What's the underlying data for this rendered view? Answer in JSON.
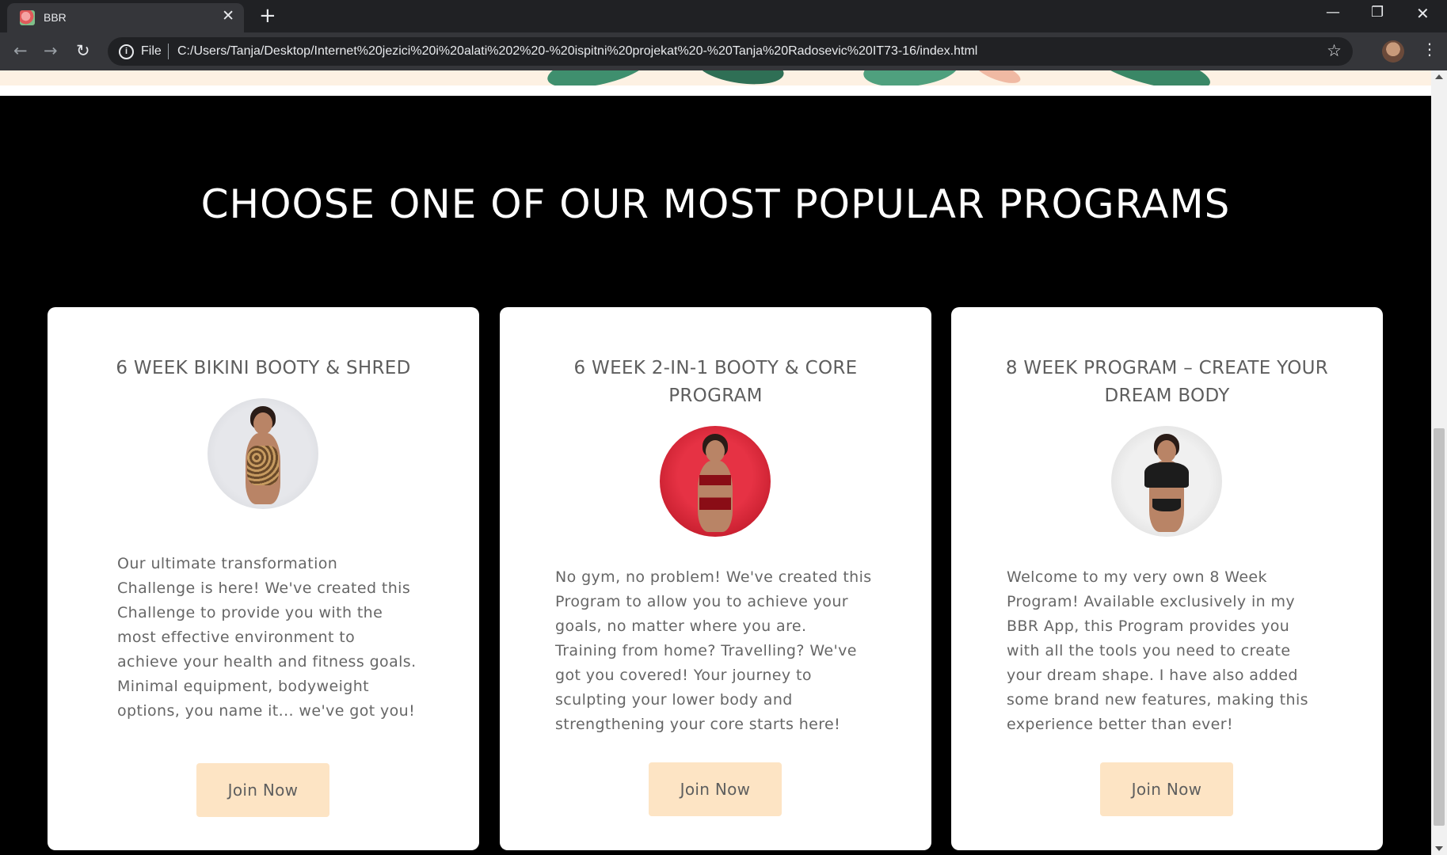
{
  "browser": {
    "tab_title": "BBR",
    "tab_close": "✕",
    "new_tab": "+",
    "scheme": "File",
    "url": "C:/Users/Tanja/Desktop/Internet%20jezici%20i%20alati%202%20-%20ispitni%20projekat%20-%20Tanja%20Radosevic%20IT73-16/index.html",
    "icons": {
      "back": "←",
      "forward": "→",
      "reload": "↻",
      "info": "i",
      "star": "☆",
      "menu": "⋮",
      "minimize": "—",
      "restore": "❐",
      "close": "✕"
    }
  },
  "page": {
    "section_title": "CHOOSE ONE OF OUR MOST POPULAR PROGRAMS",
    "programs": [
      {
        "title": "6 WEEK BIKINI BOOTY & SHRED",
        "description": "Our ultimate transformation Challenge is here! We've created this Challenge to provide you with the most effective environment to achieve your health and fitness goals. Minimal equipment, bodyweight options, you name it... we've got you!",
        "button": "Join Now"
      },
      {
        "title": "6 WEEK 2-IN-1 BOOTY & CORE PROGRAM",
        "description": "No gym, no problem! We've created this Program to allow you to achieve your goals, no matter where you are. Training from home? Travelling? We've got you covered! Your journey to sculpting your lower body and strengthening your core starts here!",
        "button": "Join Now"
      },
      {
        "title": "8 WEEK PROGRAM – CREATE YOUR DREAM BODY",
        "description": "Welcome to my very own 8 Week Program! Available exclusively in my BBR App, this Program provides you with all the tools you need to create your dream shape. I have also added some brand new features, making this experience better than ever!",
        "button": "Join Now"
      }
    ]
  },
  "colors": {
    "section_bg": "#000000",
    "card_bg": "#ffffff",
    "button_bg": "#fde4c4",
    "text": "#666666"
  }
}
